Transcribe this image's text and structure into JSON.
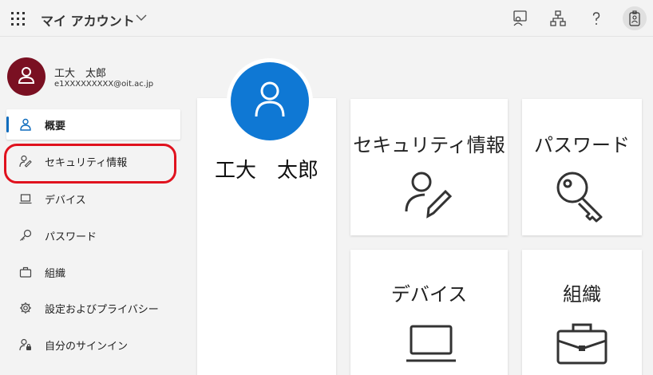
{
  "header": {
    "app_title": "マイ アカウント"
  },
  "icons": {
    "launcher": "app-launcher-icon",
    "title_chevron": "chevron-down-icon",
    "feedback": "feedback-icon",
    "org": "organization-icon",
    "help": "help-icon",
    "badge": "user-badge-icon"
  },
  "user": {
    "name": "工大　太郎",
    "email": "e1XXXXXXXXX@oit.ac.jp"
  },
  "sidebar": {
    "items": [
      {
        "label": "概要",
        "icon": "person-icon",
        "active": true
      },
      {
        "label": "セキュリティ情報",
        "icon": "person-edit-icon",
        "active": false
      },
      {
        "label": "デバイス",
        "icon": "laptop-icon",
        "active": false
      },
      {
        "label": "パスワード",
        "icon": "key-icon",
        "active": false
      },
      {
        "label": "組織",
        "icon": "briefcase-icon",
        "active": false
      },
      {
        "label": "設定およびプライバシー",
        "icon": "gear-icon",
        "active": false
      },
      {
        "label": "自分のサインイン",
        "icon": "person-lock-icon",
        "active": false
      }
    ]
  },
  "profile": {
    "name": "工大　太郎"
  },
  "tiles": [
    {
      "title": "セキュリティ情報",
      "icon": "person-edit-icon"
    },
    {
      "title": "パスワード",
      "icon": "key-icon"
    },
    {
      "title": "デバイス",
      "icon": "laptop-icon"
    },
    {
      "title": "組織",
      "icon": "briefcase-icon"
    }
  ],
  "colors": {
    "accent": "#0f6cbd",
    "avatar": "#7a1022",
    "profile_avatar": "#0f78d4",
    "highlight": "#e0121e"
  }
}
